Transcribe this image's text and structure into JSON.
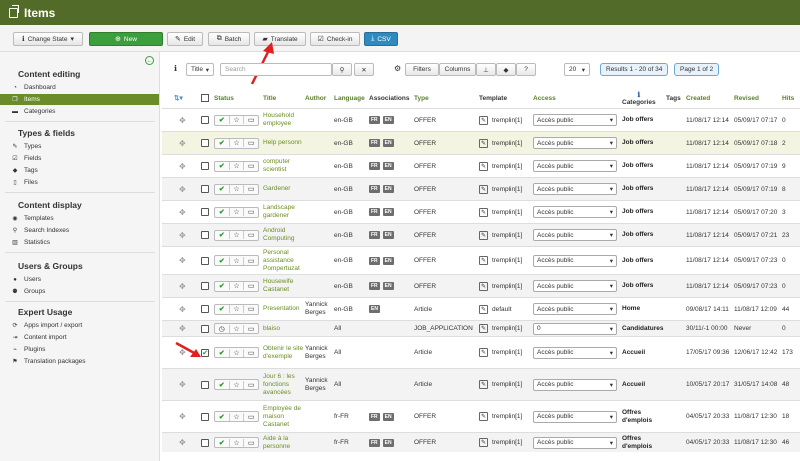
{
  "header": {
    "title": "Items"
  },
  "toolbar": {
    "change_state": "Change State",
    "new": "New",
    "edit": "Edit",
    "batch": "Batch",
    "translate": "Translate",
    "checkin": "Check-in",
    "csv": "CSV"
  },
  "sidebar": {
    "sections": [
      {
        "title": "Content editing",
        "items": [
          "Dashboard",
          "Items",
          "Categories"
        ]
      },
      {
        "title": "Types & fields",
        "items": [
          "Types",
          "Fields",
          "Tags",
          "Files"
        ]
      },
      {
        "title": "Content display",
        "items": [
          "Templates",
          "Search Indexes",
          "Statistics"
        ]
      },
      {
        "title": "Users & Groups",
        "items": [
          "Users",
          "Groups"
        ]
      },
      {
        "title": "Expert Usage",
        "items": [
          "Apps import / export",
          "Content import",
          "Plugins",
          "Translation packages"
        ]
      }
    ],
    "active": "Items"
  },
  "filters": {
    "field": "Title",
    "search_placeholder": "Search",
    "filters_label": "Filters",
    "columns_label": "Columns",
    "per_page": "20",
    "results": "Results 1 - 20 of 34",
    "page": "Page 1 of 2"
  },
  "columns": {
    "status": "Status",
    "title": "Title",
    "author": "Author",
    "language": "Language",
    "associations": "Associations",
    "type": "Type",
    "template": "Template",
    "access": "Access",
    "categories": "Categories",
    "tags": "Tags",
    "created": "Created",
    "revised": "Revised",
    "hits": "Hits"
  },
  "rows": [
    {
      "title": "Household employee",
      "author": "",
      "language": "en-GB",
      "assoc": [
        "FR",
        "EN"
      ],
      "type": "OFFER",
      "template": "tremplin[1]",
      "access": "Accès public",
      "category": "Job offers",
      "created": "11/08/17 12:14",
      "revised": "05/09/17 07:17",
      "hits": "0"
    },
    {
      "title": "Help personn",
      "author": "",
      "language": "en-GB",
      "assoc": [
        "FR",
        "EN"
      ],
      "type": "OFFER",
      "template": "tremplin[1]",
      "access": "Accès public",
      "category": "Job offers",
      "created": "11/08/17 12:14",
      "revised": "05/09/17 07:18",
      "hits": "2"
    },
    {
      "title": "computer scientist",
      "author": "",
      "language": "en-GB",
      "assoc": [
        "FR",
        "EN"
      ],
      "type": "OFFER",
      "template": "tremplin[1]",
      "access": "Accès public",
      "category": "Job offers",
      "created": "11/08/17 12:14",
      "revised": "05/09/17 07:19",
      "hits": "9"
    },
    {
      "title": "Gardener",
      "author": "",
      "language": "en-GB",
      "assoc": [
        "FR",
        "EN"
      ],
      "type": "OFFER",
      "template": "tremplin[1]",
      "access": "Accès public",
      "category": "Job offers",
      "created": "11/08/17 12:14",
      "revised": "05/09/17 07:19",
      "hits": "8"
    },
    {
      "title": "Landscape gardener",
      "author": "",
      "language": "en-GB",
      "assoc": [
        "FR",
        "EN"
      ],
      "type": "OFFER",
      "template": "tremplin[1]",
      "access": "Accès public",
      "category": "Job offers",
      "created": "11/08/17 12:14",
      "revised": "05/09/17 07:20",
      "hits": "3"
    },
    {
      "title": "Android Computing",
      "author": "",
      "language": "en-GB",
      "assoc": [
        "FR",
        "EN"
      ],
      "type": "OFFER",
      "template": "tremplin[1]",
      "access": "Accès public",
      "category": "Job offers",
      "created": "11/08/17 12:14",
      "revised": "05/09/17 07:21",
      "hits": "23"
    },
    {
      "title": "Personal assistance Pompertuzat",
      "author": "",
      "language": "en-GB",
      "assoc": [
        "FR",
        "EN"
      ],
      "type": "OFFER",
      "template": "tremplin[1]",
      "access": "Accès public",
      "category": "Job offers",
      "created": "11/08/17 12:14",
      "revised": "05/09/17 07:23",
      "hits": "0"
    },
    {
      "title": "Housewife Castanet",
      "author": "",
      "language": "en-GB",
      "assoc": [
        "FR",
        "EN"
      ],
      "type": "OFFER",
      "template": "tremplin[1]",
      "access": "Accès public",
      "category": "Job offers",
      "created": "11/08/17 12:14",
      "revised": "05/09/17 07:23",
      "hits": "0"
    },
    {
      "title": "Presentation",
      "author": "Yannick Berges",
      "language": "en-GB",
      "assoc": [
        "EN"
      ],
      "type": "Article",
      "template": "default",
      "access": "Accès public",
      "category": "Home",
      "created": "09/08/17 14:11",
      "revised": "11/08/17 12:09",
      "hits": "44"
    },
    {
      "title": "blaiso",
      "author": "",
      "language": "All",
      "assoc": [],
      "type": "JOB_APPLICATION",
      "template": "tremplin[1]",
      "access": "0",
      "category": "Candidatures",
      "created": "30/11/-1 00:00",
      "revised": "Never",
      "hits": "0"
    },
    {
      "title": "Obtenir le site d'exemple",
      "author": "Yannick Berges",
      "language": "All",
      "assoc": [],
      "type": "Article",
      "template": "tremplin[1]",
      "access": "Accès public",
      "category": "Accueil",
      "created": "17/05/17 09:36",
      "revised": "12/06/17 12:42",
      "hits": "173"
    },
    {
      "title": "Jour 6 : les fonctions avancées",
      "author": "Yannick Berges",
      "language": "All",
      "assoc": [],
      "type": "Article",
      "template": "tremplin[1]",
      "access": "Accès public",
      "category": "Accueil",
      "created": "10/05/17 20:17",
      "revised": "31/05/17 14:08",
      "hits": "48"
    },
    {
      "title": "Employée de maison Castanet",
      "author": "",
      "language": "fr-FR",
      "assoc": [
        "FR",
        "EN"
      ],
      "type": "OFFER",
      "template": "tremplin[1]",
      "access": "Accès public",
      "category": "Offres d'emplois",
      "created": "04/05/17 20:33",
      "revised": "11/08/17 12:30",
      "hits": "18"
    },
    {
      "title": "Aide à la personne",
      "author": "",
      "language": "fr-FR",
      "assoc": [
        "FR",
        "EN"
      ],
      "type": "OFFER",
      "template": "tremplin[1]",
      "access": "Accès public",
      "category": "Offres d'emplois",
      "created": "04/05/17 20:33",
      "revised": "11/08/17 12:30",
      "hits": "46"
    }
  ]
}
